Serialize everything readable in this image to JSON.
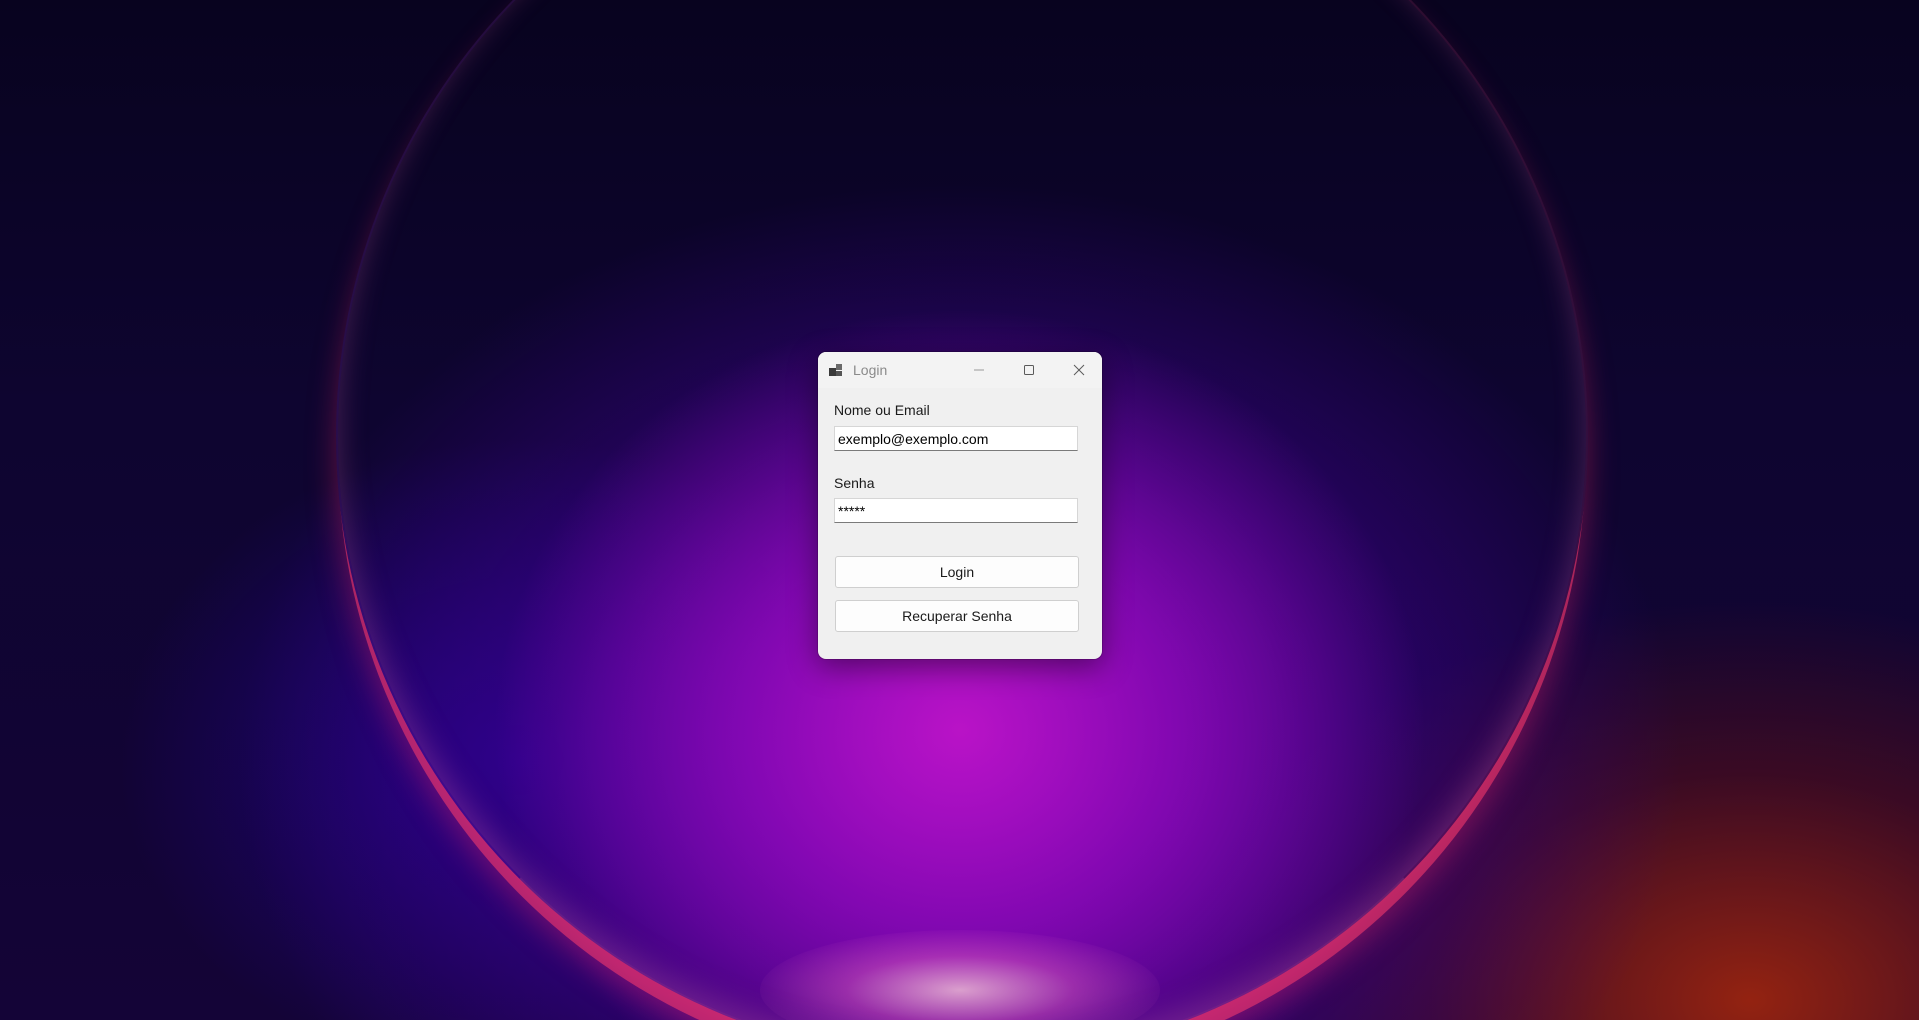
{
  "window": {
    "title": "Login",
    "controls": {
      "minimize": "minimize-icon",
      "maximize": "maximize-icon",
      "close": "close-icon"
    }
  },
  "form": {
    "name_label": "Nome ou Email",
    "name_value": "exemplo@exemplo.com",
    "password_label": "Senha",
    "password_value": "*****",
    "login_button": "Login",
    "recover_button": "Recuperar Senha"
  },
  "colors": {
    "window_bg": "#f0f0f0",
    "titlebar_bg": "#f3f3f3",
    "title_text": "#8a8a8a"
  }
}
